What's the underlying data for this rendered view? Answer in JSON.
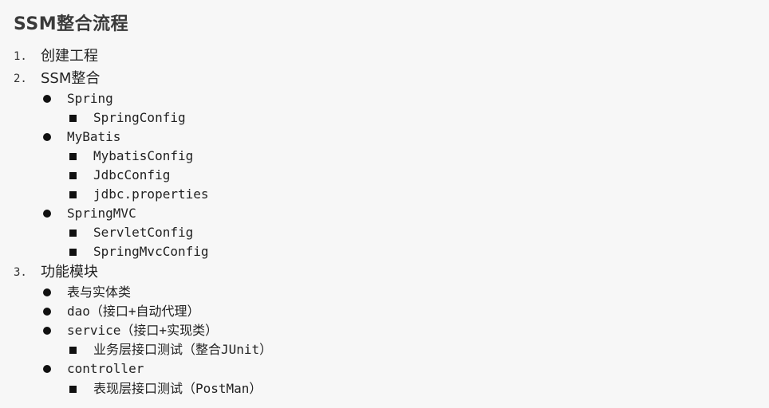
{
  "title": "SSM整合流程",
  "items": {
    "i1": {
      "num": "1.",
      "label": "创建工程"
    },
    "i2": {
      "num": "2.",
      "label": "SSM整合"
    },
    "i2_spring": "Spring",
    "i2_spring_config": "SpringConfig",
    "i2_mybatis": "MyBatis",
    "i2_mybatis_config": "MybatisConfig",
    "i2_jdbc_config": "JdbcConfig",
    "i2_jdbc_props": "jdbc.properties",
    "i2_springmvc": "SpringMVC",
    "i2_servlet_config": "ServletConfig",
    "i2_springmvc_config": "SpringMvcConfig",
    "i3": {
      "num": "3.",
      "label": "功能模块"
    },
    "i3_table": "表与实体类",
    "i3_dao": "dao（接口+自动代理）",
    "i3_service": "service（接口+实现类）",
    "i3_service_test": "业务层接口测试（整合JUnit）",
    "i3_controller": "controller",
    "i3_controller_test": "表现层接口测试（PostMan）"
  }
}
